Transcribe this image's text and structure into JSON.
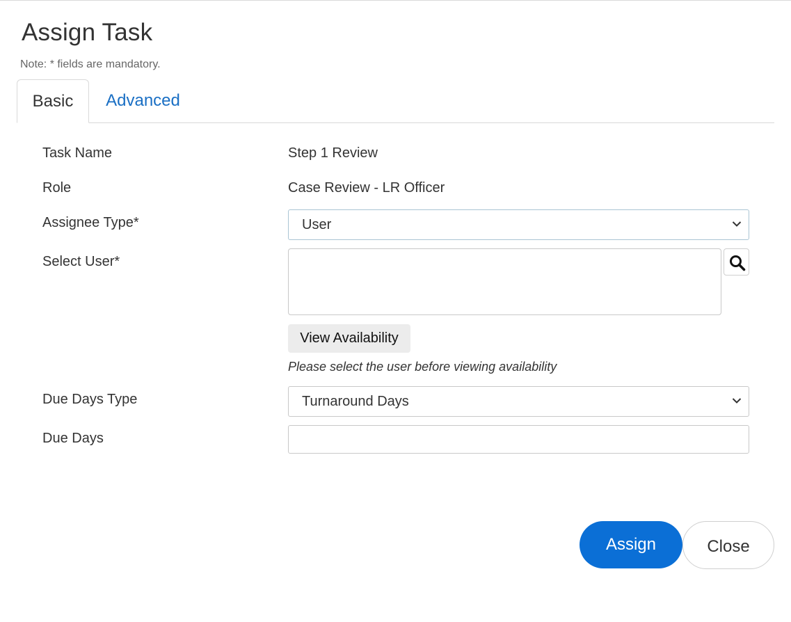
{
  "dialog": {
    "title": "Assign Task",
    "note": "Note: * fields are mandatory."
  },
  "tabs": [
    {
      "label": "Basic",
      "active": true
    },
    {
      "label": "Advanced",
      "active": false
    }
  ],
  "form": {
    "task_name": {
      "label": "Task Name",
      "value": "Step 1 Review"
    },
    "role": {
      "label": "Role",
      "value": "Case Review - LR Officer"
    },
    "assignee_type": {
      "label": "Assignee Type*",
      "selected": "User"
    },
    "select_user": {
      "label": "Select User*",
      "value": ""
    },
    "view_availability": {
      "label": "View Availability",
      "hint": "Please select the user before viewing availability"
    },
    "due_days_type": {
      "label": "Due Days Type",
      "selected": "Turnaround Days"
    },
    "due_days": {
      "label": "Due Days",
      "value": ""
    }
  },
  "footer": {
    "assign_label": "Assign",
    "close_label": "Close"
  },
  "icons": {
    "search": "search-icon",
    "chevron": "chevron-down-icon"
  },
  "colors": {
    "primary": "#0b6fd6",
    "link": "#1a6fc4"
  }
}
